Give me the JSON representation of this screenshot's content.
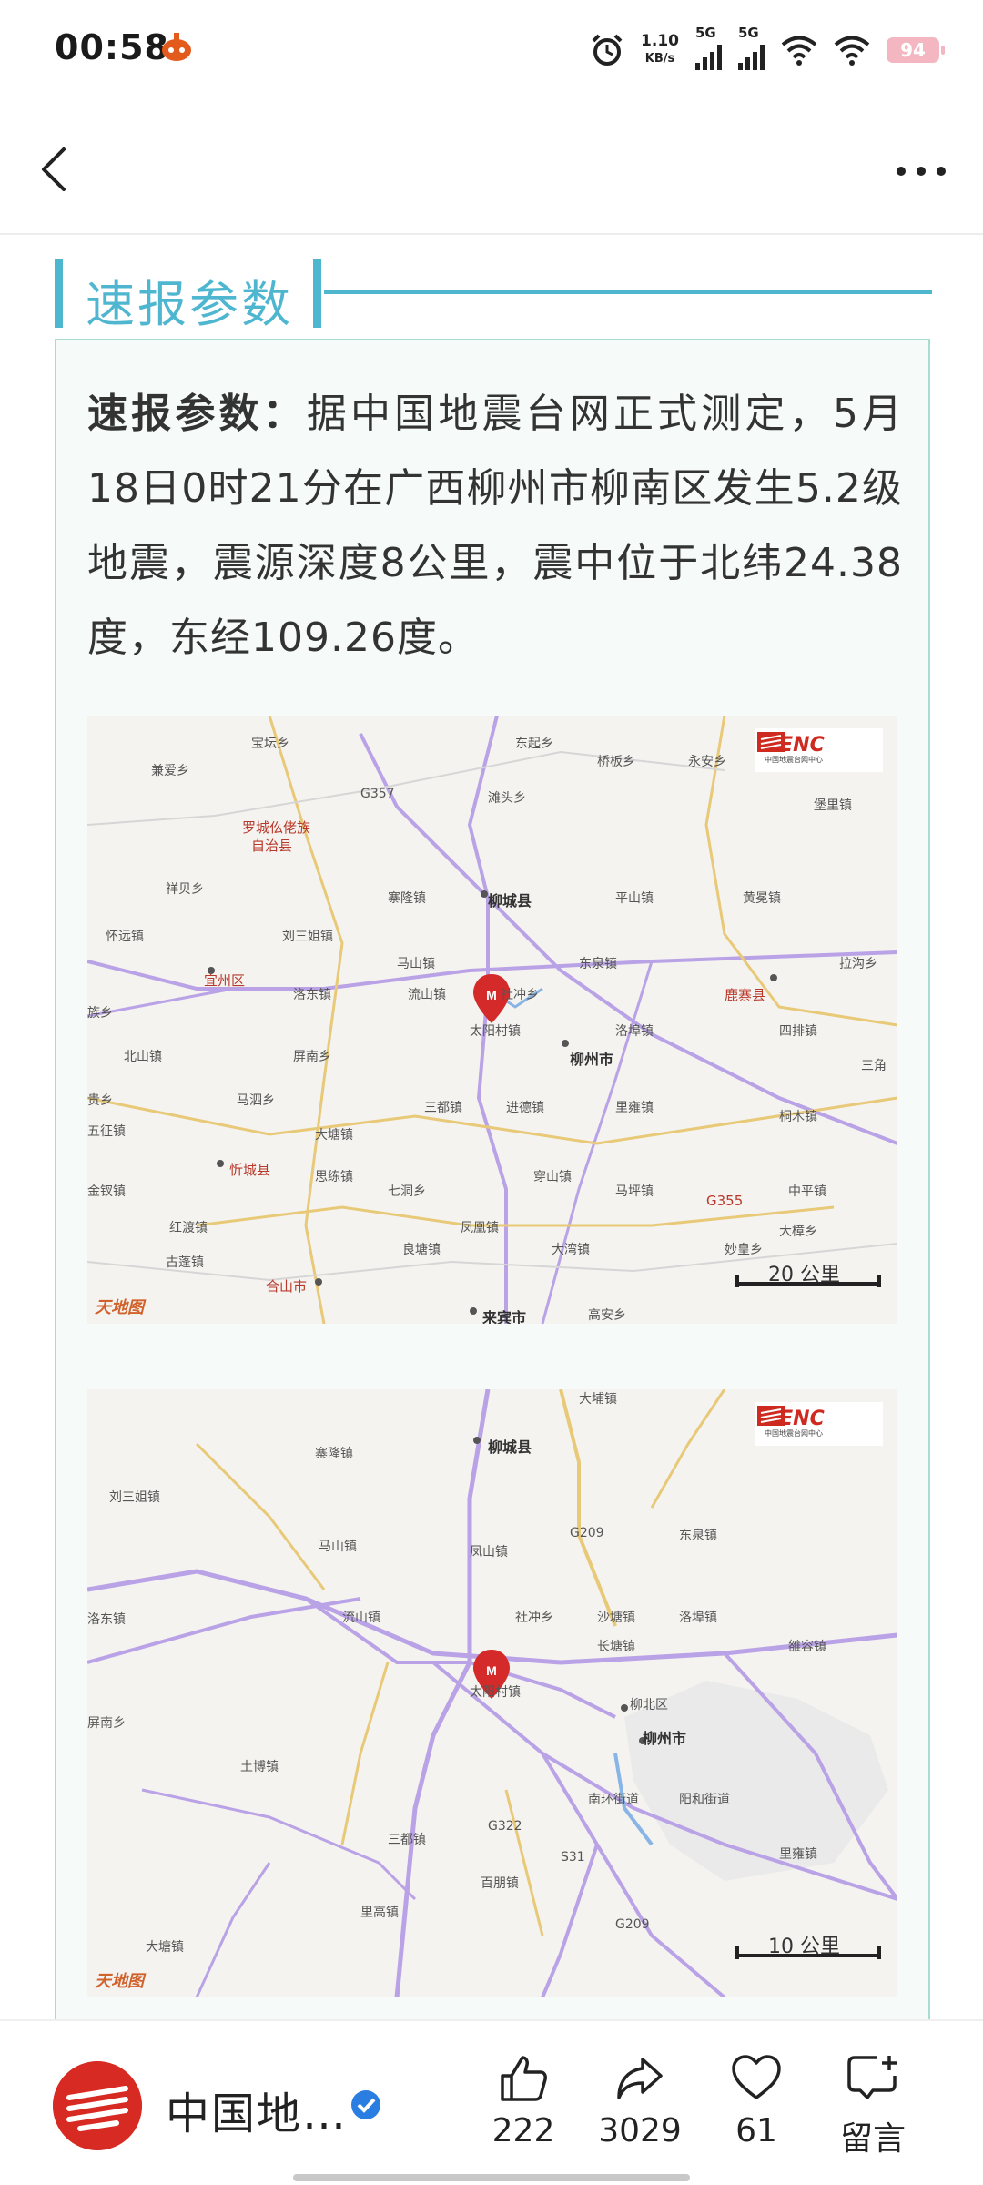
{
  "status_bar": {
    "time": "00:58",
    "net_speed_value": "1.10",
    "net_speed_unit": "KB/s",
    "sim1": "5G",
    "sim2": "5G",
    "battery": "94"
  },
  "section": {
    "title": "速报参数"
  },
  "article": {
    "lead": "速报参数：",
    "body": "据中国地震台网正式测定，5月18日0时21分在广西柳州市柳南区发生5.2级地震，震源深度8公里，震中位于北纬24.38度，东经109.26度。"
  },
  "map1": {
    "brand": "CENC",
    "brand_sub": "中国地震台网中心",
    "scale": "20 公里",
    "watermark": "天地图",
    "labels": [
      "宝坛乡",
      "东起乡",
      "桥板乡",
      "永安乡",
      "兼爱乡",
      "G357",
      "滩头乡",
      "堡里镇",
      "罗城仫佬族",
      "自治县",
      "祥贝乡",
      "寨隆镇",
      "柳城县",
      "平山镇",
      "黄冕镇",
      "怀远镇",
      "刘三姐镇",
      "马山镇",
      "东泉镇",
      "拉沟乡",
      "宜州区",
      "洛东镇",
      "流山镇",
      "社冲乡",
      "鹿寨县",
      "族乡",
      "太阳村镇",
      "洛埠镇",
      "四排镇",
      "北山镇",
      "屏南乡",
      "柳州市",
      "三角",
      "贵乡",
      "马泗乡",
      "三都镇",
      "进德镇",
      "里雍镇",
      "桐木镇",
      "五征镇",
      "大塘镇",
      "忻城县",
      "思练镇",
      "穿山镇",
      "金钗镇",
      "七洞乡",
      "马坪镇",
      "中平镇",
      "红渡镇",
      "凤凰镇",
      "G355",
      "古蓬镇",
      "良塘镇",
      "大湾镇",
      "妙皇乡",
      "大樟乡",
      "合山市",
      "来宾市",
      "高安乡"
    ]
  },
  "map2": {
    "brand": "CENC",
    "brand_sub": "中国地震台网中心",
    "scale": "10 公里",
    "watermark": "天地图",
    "labels": [
      "大埔镇",
      "寨隆镇",
      "柳城县",
      "刘三姐镇",
      "G209",
      "东泉镇",
      "马山镇",
      "凤山镇",
      "洛东镇",
      "流山镇",
      "社冲乡",
      "沙塘镇",
      "洛埠镇",
      "长塘镇",
      "雒容镇",
      "太阳村镇",
      "柳北区",
      "屏南乡",
      "柳州市",
      "土博镇",
      "南环街道",
      "阳和街道",
      "G322",
      "S31",
      "三都镇",
      "里雍镇",
      "百朋镇",
      "里高镇",
      "大塘镇",
      "G209"
    ]
  },
  "bottom_bar": {
    "account_name": "中国地…",
    "like_count": "222",
    "share_count": "3029",
    "fav_count": "61",
    "comment_label": "留言"
  }
}
